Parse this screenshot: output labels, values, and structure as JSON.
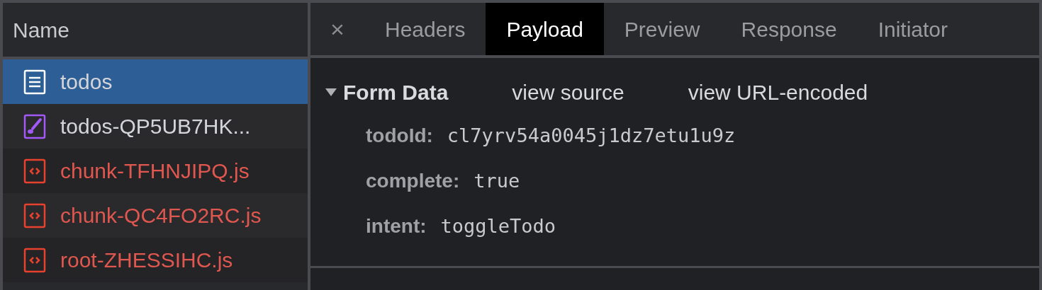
{
  "requests": {
    "header": "Name",
    "rows": [
      {
        "name": "todos",
        "kind": "document",
        "selected": true,
        "failed": false
      },
      {
        "name": "todos-QP5UB7HK...",
        "kind": "stylesheet",
        "selected": false,
        "failed": false
      },
      {
        "name": "chunk-TFHNJIPQ.js",
        "kind": "script",
        "selected": false,
        "failed": true
      },
      {
        "name": "chunk-QC4FO2RC.js",
        "kind": "script",
        "selected": false,
        "failed": true
      },
      {
        "name": "root-ZHESSIHC.js",
        "kind": "script",
        "selected": false,
        "failed": true
      }
    ]
  },
  "details": {
    "close": "×",
    "tabs": [
      {
        "label": "Headers",
        "selected": false
      },
      {
        "label": "Payload",
        "selected": true
      },
      {
        "label": "Preview",
        "selected": false
      },
      {
        "label": "Response",
        "selected": false
      },
      {
        "label": "Initiator",
        "selected": false
      }
    ],
    "section": {
      "title": "Form Data",
      "expanded": true,
      "links": [
        "view source",
        "view URL-encoded"
      ],
      "fields": [
        {
          "key": "todoId:",
          "value": "cl7yrv54a0045j1dz7etu1u9z"
        },
        {
          "key": "complete:",
          "value": "true"
        },
        {
          "key": "intent:",
          "value": "toggleTodo"
        }
      ]
    }
  }
}
